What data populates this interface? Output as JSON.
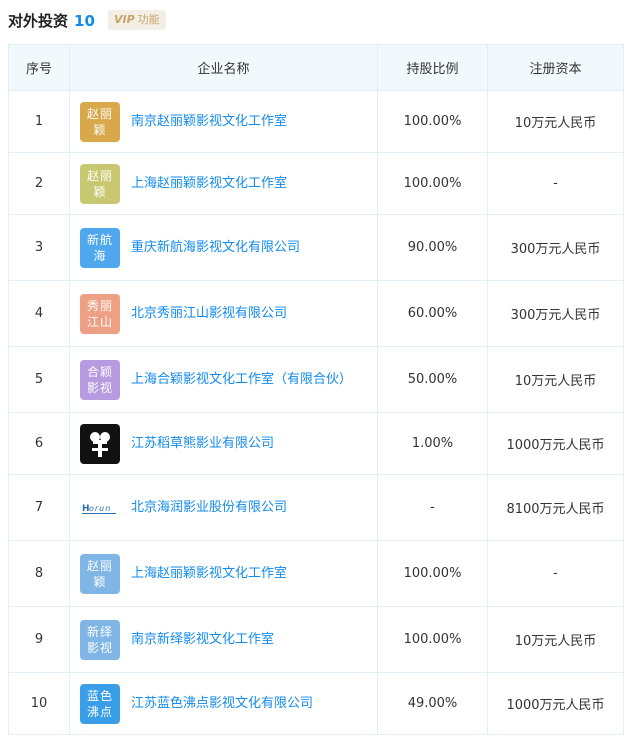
{
  "section": {
    "title": "对外投资",
    "count": "10",
    "vip_label": "功能",
    "vip_prefix": "VIP"
  },
  "table": {
    "headers": [
      "序号",
      "企业名称",
      "持股比例",
      "注册资本"
    ],
    "rows": [
      {
        "no": "1",
        "logo": "赵丽颖",
        "name": "南京赵丽颖影视文化工作室",
        "ratio": "100.00%",
        "capital": "10万元人民币"
      },
      {
        "no": "2",
        "logo": "赵丽颖",
        "name": "上海赵丽颖影视文化工作室",
        "ratio": "100.00%",
        "capital": "-"
      },
      {
        "no": "3",
        "logo": "新航海",
        "name": "重庆新航海影视文化有限公司",
        "ratio": "90.00%",
        "capital": "300万元人民币"
      },
      {
        "no": "4",
        "logo": "秀丽江山",
        "name": "北京秀丽江山影视有限公司",
        "ratio": "60.00%",
        "capital": "300万元人民币"
      },
      {
        "no": "5",
        "logo": "合颖影视",
        "name": "上海合颖影视文化工作室（有限合伙）",
        "ratio": "50.00%",
        "capital": "10万元人民币"
      },
      {
        "no": "6",
        "logo": "",
        "name": "江苏稻草熊影业有限公司",
        "ratio": "1.00%",
        "capital": "1000万元人民币"
      },
      {
        "no": "7",
        "logo": "",
        "name": "北京海润影业股份有限公司",
        "ratio": "-",
        "capital": "8100万元人民币"
      },
      {
        "no": "8",
        "logo": "赵丽颖",
        "name": "上海赵丽颖影视文化工作室",
        "ratio": "100.00%",
        "capital": "-"
      },
      {
        "no": "9",
        "logo": "新绎影视",
        "name": "南京新绎影视文化工作室",
        "ratio": "100.00%",
        "capital": "10万元人民币"
      },
      {
        "no": "10",
        "logo": "蓝色沸点",
        "name": "江苏蓝色沸点影视文化有限公司",
        "ratio": "49.00%",
        "capital": "1000万元人民币"
      }
    ]
  }
}
